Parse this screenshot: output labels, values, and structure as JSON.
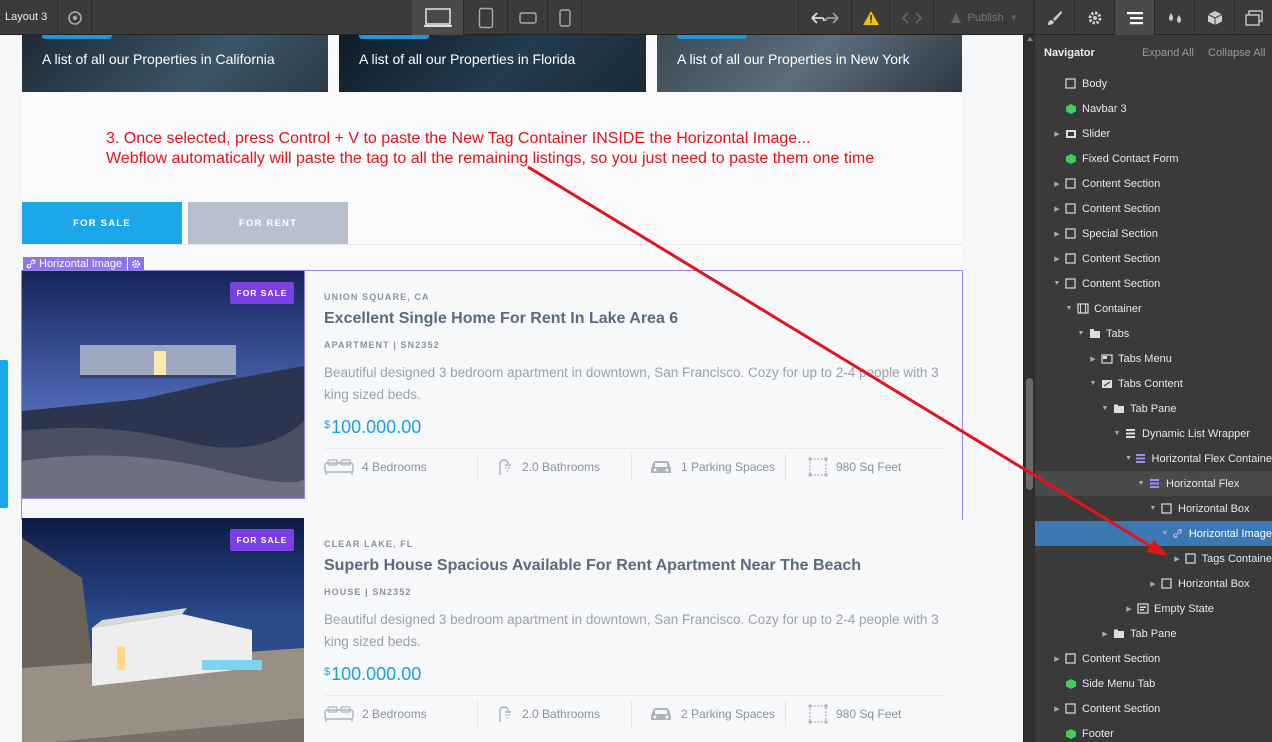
{
  "toolbar": {
    "page_name": "Layout 3",
    "publish_label": "Publish"
  },
  "city_cards": [
    {
      "label": "A list of all our Properties in California"
    },
    {
      "label": "A list of all our Properties in Florida"
    },
    {
      "label": "A list of all our Properties in New York"
    }
  ],
  "annotation": {
    "line1": "3. Once selected, press Control + V to paste the New Tag Container INSIDE the Horizontal Image...",
    "line2": "Webflow automatically will paste the tag to all the remaining listings, so you just need to paste them one time"
  },
  "tabs": {
    "sale": "FOR SALE",
    "rent": "FOR RENT"
  },
  "selection_label": "Horizontal Image",
  "listings": [
    {
      "badge": "FOR SALE",
      "location": "UNION SQUARE, CA",
      "title": "Excellent Single Home For Rent In Lake Area 6",
      "type": "APARTMENT  |  SN2352",
      "description": "Beautiful designed 3 bedroom apartment in downtown, San Francisco. Cozy for up to 2-4 people with 3 king sized beds.",
      "currency": "$",
      "price": "100.000.00",
      "bedrooms": "4 Bedrooms",
      "bathrooms": "2.0 Bathrooms",
      "parking": "1 Parking Spaces",
      "area": "980 Sq Feet"
    },
    {
      "badge": "FOR SALE",
      "location": "CLEAR LAKE, FL",
      "title": "Superb House Spacious Available For Rent Apartment Near The Beach",
      "type": "HOUSE  |  SN2352",
      "description": "Beautiful designed 3 bedroom apartment in downtown, San Francisco. Cozy for up to 2-4 people with 3 king sized beds.",
      "currency": "$",
      "price": "100.000.00",
      "bedrooms": "2 Bedrooms",
      "bathrooms": "2.0 Bathrooms",
      "parking": "2 Parking Spaces",
      "area": "980 Sq Feet"
    }
  ],
  "navigator": {
    "title": "Navigator",
    "expand_all": "Expand All",
    "collapse_all": "Collapse All",
    "items": [
      {
        "label": "Body",
        "icon": "box-icon"
      },
      {
        "label": "Navbar 3",
        "icon": "symbol-icon"
      },
      {
        "label": "Slider",
        "icon": "slider-icon"
      },
      {
        "label": "Fixed Contact Form",
        "icon": "symbol-icon"
      },
      {
        "label": "Content Section",
        "icon": "box-icon"
      },
      {
        "label": "Content Section",
        "icon": "box-icon"
      },
      {
        "label": "Special Section",
        "icon": "box-icon"
      },
      {
        "label": "Content Section",
        "icon": "box-icon"
      },
      {
        "label": "Content Section",
        "icon": "box-icon"
      },
      {
        "label": "Container",
        "icon": "container-icon"
      },
      {
        "label": "Tabs",
        "icon": "tabs-icon"
      },
      {
        "label": "Tabs Menu",
        "icon": "tabs-menu-icon"
      },
      {
        "label": "Tabs Content",
        "icon": "tabs-content-icon"
      },
      {
        "label": "Tab Pane",
        "icon": "tab-pane-icon"
      },
      {
        "label": "Dynamic List Wrapper",
        "icon": "list-icon"
      },
      {
        "label": "Horizontal Flex Containe",
        "icon": "collection-icon"
      },
      {
        "label": "Horizontal Flex",
        "icon": "collection-icon"
      },
      {
        "label": "Horizontal Box",
        "icon": "box-icon"
      },
      {
        "label": "Horizontal Image",
        "icon": "link-icon"
      },
      {
        "label": "Tags Containe",
        "icon": "box-icon"
      },
      {
        "label": "Horizontal Box",
        "icon": "box-icon"
      },
      {
        "label": "Empty State",
        "icon": "empty-state-icon"
      },
      {
        "label": "Tab Pane",
        "icon": "tab-pane-icon"
      },
      {
        "label": "Content Section",
        "icon": "box-icon"
      },
      {
        "label": "Side Menu Tab",
        "icon": "symbol-icon"
      },
      {
        "label": "Content Section",
        "icon": "box-icon"
      },
      {
        "label": "Footer",
        "icon": "symbol-icon"
      }
    ]
  },
  "colors": {
    "accent_blue": "#1ba6ea",
    "badge_purple": "#7b3fe4",
    "selection_purple": "#8f74e6",
    "annotation_red": "#e3131c",
    "navigator_selected": "#3c78b3",
    "symbol_green": "#3ecf5a"
  }
}
